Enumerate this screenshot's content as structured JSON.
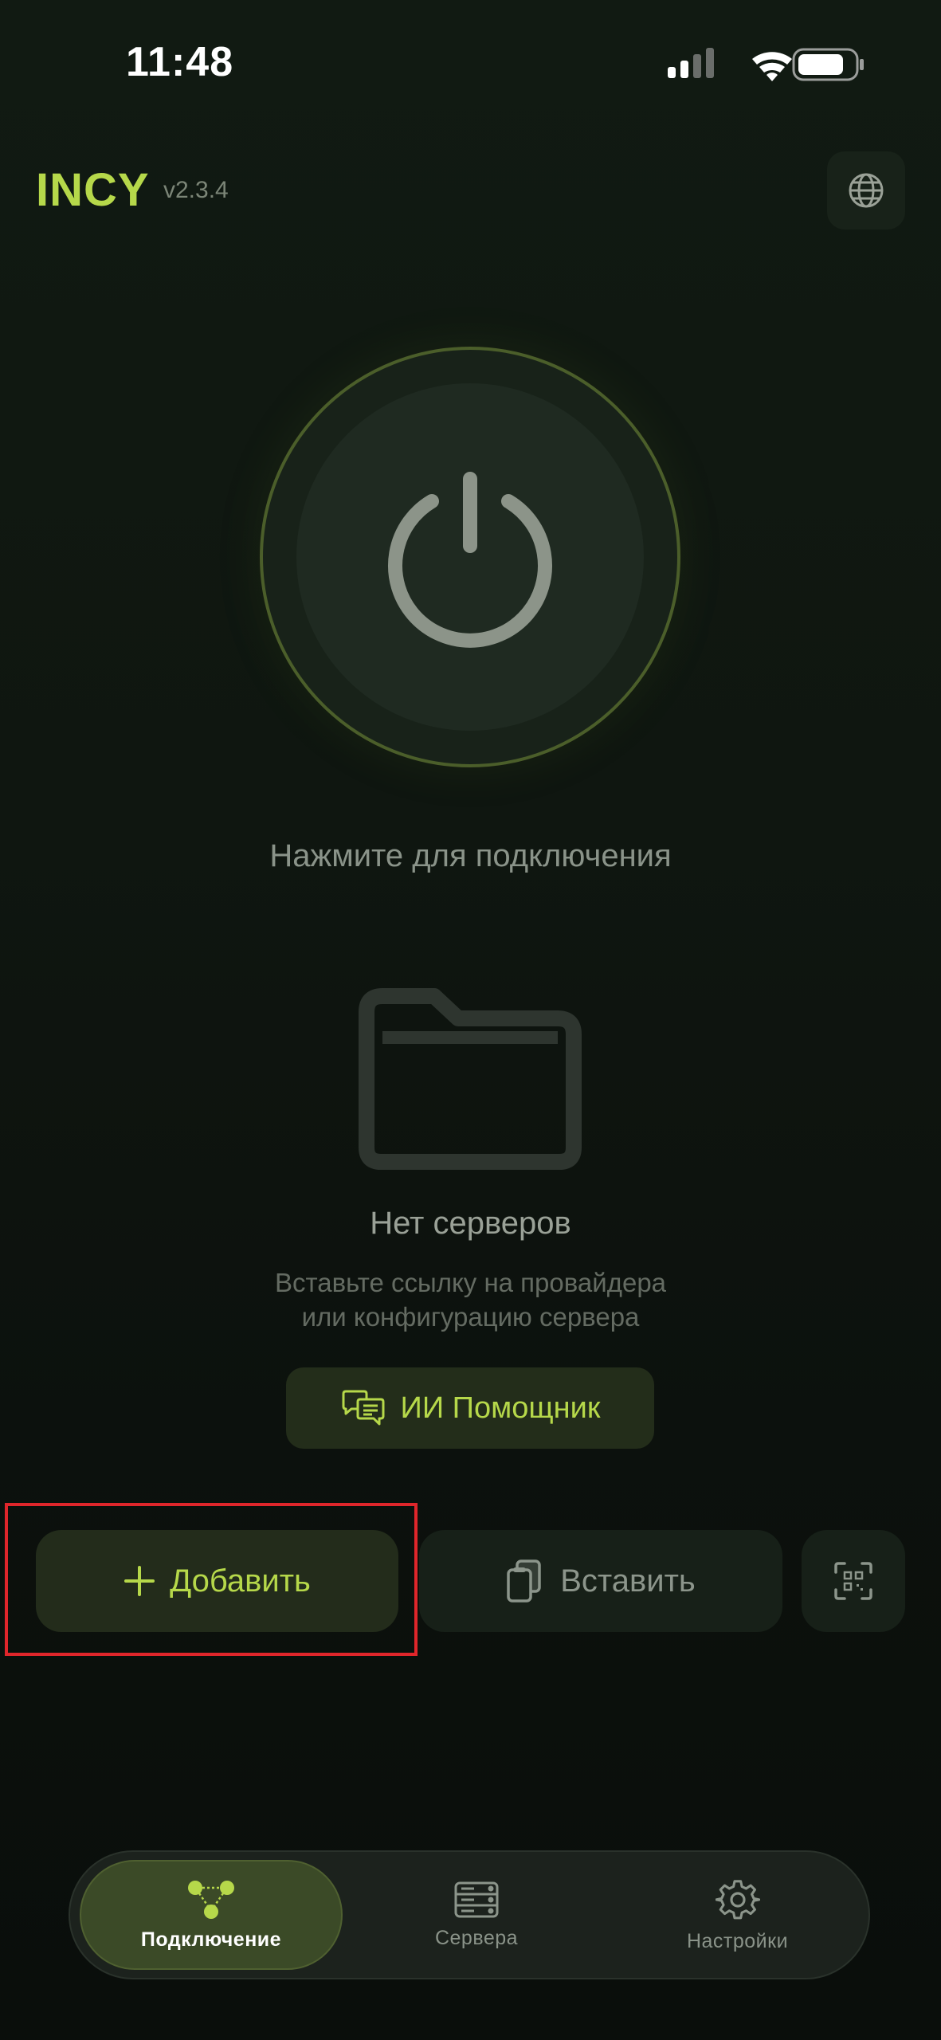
{
  "status_bar": {
    "time": "11:48"
  },
  "header": {
    "logo": "INCY",
    "version": "v2.3.4",
    "language_icon": "globe-icon"
  },
  "power": {
    "icon": "power-icon",
    "hint": "Нажмите для подключения"
  },
  "empty_state": {
    "icon": "folder-icon",
    "title": "Нет серверов",
    "subtitle_line1": "Вставьте ссылку на провайдера",
    "subtitle_line2": "или конфигурацию сервера"
  },
  "ai_button": {
    "icon": "chat-bubbles-icon",
    "label": "ИИ Помощник"
  },
  "actions": {
    "add": {
      "icon": "plus-icon",
      "label": "Добавить"
    },
    "paste": {
      "icon": "clipboard-icon",
      "label": "Вставить"
    },
    "scan": {
      "icon": "qr-scan-icon"
    }
  },
  "nav": {
    "items": [
      {
        "label": "Подключение",
        "icon": "connection-nodes-icon",
        "active": true
      },
      {
        "label": "Сервера",
        "icon": "server-stack-icon",
        "active": false
      },
      {
        "label": "Настройки",
        "icon": "gear-icon",
        "active": false
      }
    ]
  },
  "colors": {
    "accent": "#b6d84a",
    "background": "#0f1610",
    "highlight": "#e0262b"
  }
}
